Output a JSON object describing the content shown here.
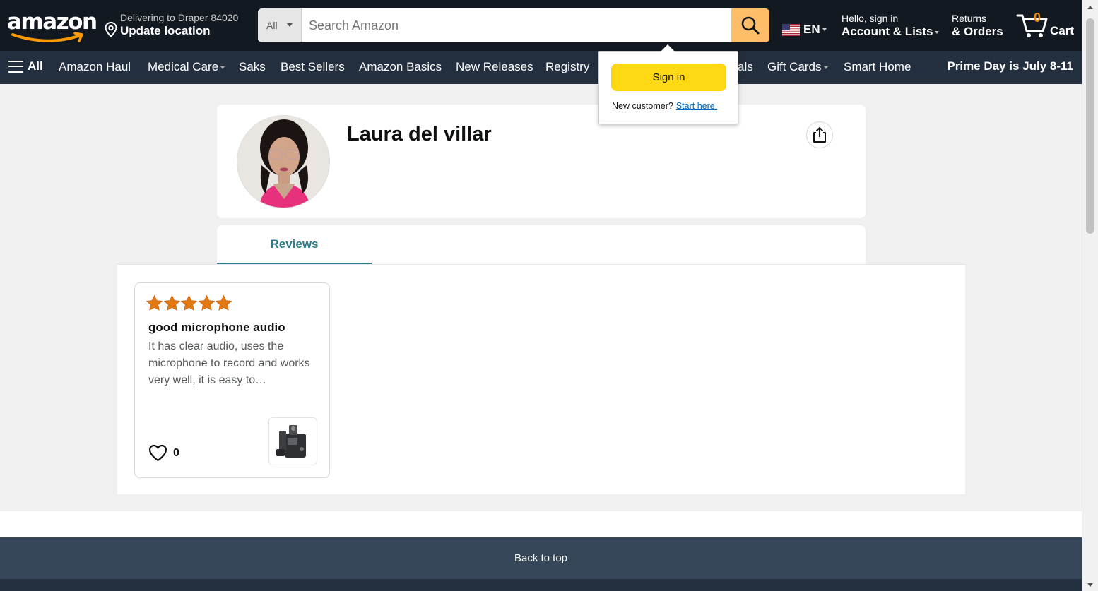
{
  "header": {
    "logo_text": "amazon",
    "deliver_line1": "Delivering to Draper 84020",
    "deliver_line2": "Update location",
    "search_category": "All",
    "search_placeholder": "Search Amazon",
    "language": "EN",
    "account_line1": "Hello, sign in",
    "account_line2": "Account & Lists",
    "orders_line1": "Returns",
    "orders_line2": "& Orders",
    "cart_count": "0",
    "cart_label": "Cart"
  },
  "nav": {
    "all_label": "All",
    "items": [
      "Amazon Haul",
      "Medical Care",
      "Saks",
      "Best Sellers",
      "Amazon Basics",
      "New Releases",
      "Registry",
      "als",
      "Gift Cards",
      "Smart Home"
    ],
    "promo": "Prime Day is July 8-11"
  },
  "signin_flyout": {
    "button": "Sign in",
    "new_customer": "New customer?",
    "start_here": "Start here."
  },
  "profile": {
    "name": "Laura del villar"
  },
  "tabs": {
    "reviews": "Reviews"
  },
  "review": {
    "rating": 5,
    "title": "good microphone audio",
    "body": "It has clear audio, uses the microphone to record and works very well, it is easy to…",
    "helpful_count": "0"
  },
  "footer": {
    "back_to_top": "Back to top"
  },
  "colors": {
    "header_bg": "#131921",
    "nav_bg": "#232f3e",
    "search_button": "#febd69",
    "signin_button": "#ffd814",
    "star": "#e47911",
    "tab_accent": "#2c7d8c",
    "back_to_top_bg": "#37475a"
  }
}
